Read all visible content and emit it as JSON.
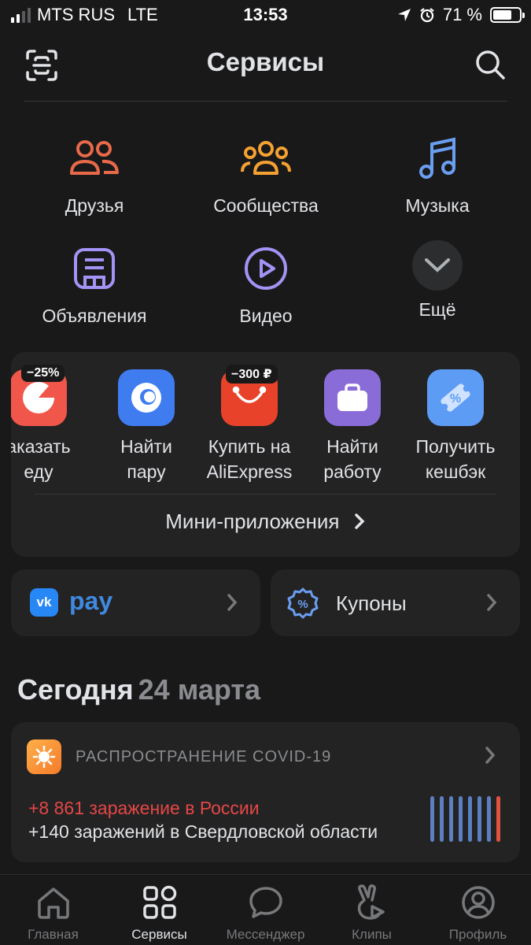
{
  "status_bar": {
    "carrier": "MTS RUS",
    "network": "LTE",
    "time": "13:53",
    "battery": "71 %",
    "battery_level_percent": 71
  },
  "header": {
    "title": "Сервисы",
    "icons": [
      "scan-icon",
      "search-icon"
    ]
  },
  "services": [
    {
      "label": "Друзья",
      "icon": "friends-icon",
      "color": "#e8694a"
    },
    {
      "label": "Сообщества",
      "icon": "communities-icon",
      "color": "#f4a132"
    },
    {
      "label": "Музыка",
      "icon": "music-icon",
      "color": "#6a9ef0"
    },
    {
      "label": "Объявления",
      "icon": "classifieds-icon",
      "color": "#a393f5"
    },
    {
      "label": "Видео",
      "icon": "video-icon",
      "color": "#a393f5"
    },
    {
      "label": "Ещё",
      "icon": "chevron-down-icon"
    }
  ],
  "mini_apps": {
    "items": [
      {
        "label": "аказать\nеду",
        "badge": "−25%",
        "icon": "delivery-club-icon",
        "color": "#f0564a"
      },
      {
        "label": "Найти\nпару",
        "badge": "",
        "icon": "dating-icon",
        "color": "#3f7cf0"
      },
      {
        "label": "Купить на\nAliExpress",
        "badge": "−300 ₽",
        "icon": "aliexpress-icon",
        "color": "#e8432a"
      },
      {
        "label": "Найти\nработу",
        "badge": "",
        "icon": "job-icon",
        "color": "#8a6cd8"
      },
      {
        "label": "Получить\nкешбэк",
        "badge": "",
        "icon": "cashback-icon",
        "color": "#5c9cf5"
      }
    ],
    "link_label": "Мини-приложения"
  },
  "vkpay": {
    "label": "pay",
    "icon": "vk-logo-icon"
  },
  "coupons": {
    "label": "Купоны",
    "icon": "coupon-icon"
  },
  "today": {
    "label": "Сегодня",
    "date": "24 марта"
  },
  "covid": {
    "title": "РАСПРОСТРАНЕНИЕ COVID-19",
    "line_red": "+8 861 заражение в России",
    "line_white": "+140 заражений в Свердловской области",
    "chart_colors": [
      "#5b7fc0",
      "#5b7fc0",
      "#5b7fc0",
      "#5b7fc0",
      "#5b7fc0",
      "#5b7fc0",
      "#5b7fc0",
      "#e0533f"
    ]
  },
  "tabbar": [
    {
      "label": "Главная",
      "icon": "home-icon",
      "active": false
    },
    {
      "label": "Сервисы",
      "icon": "services-icon",
      "active": true
    },
    {
      "label": "Мессенджер",
      "icon": "messenger-icon",
      "active": false
    },
    {
      "label": "Клипы",
      "icon": "clips-icon",
      "active": false
    },
    {
      "label": "Профиль",
      "icon": "profile-icon",
      "active": false
    }
  ]
}
